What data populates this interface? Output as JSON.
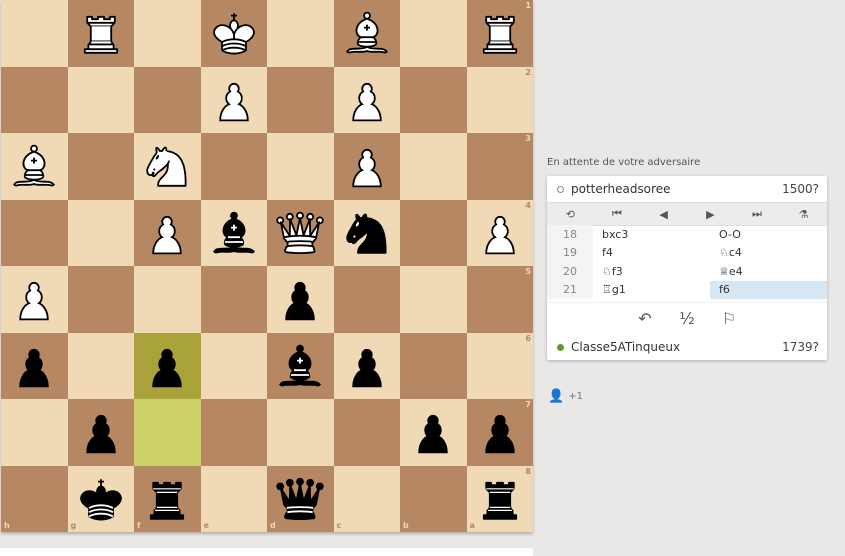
{
  "board": {
    "orientation": "black",
    "files_display": [
      "h",
      "g",
      "f",
      "e",
      "d",
      "c",
      "b",
      "a"
    ],
    "ranks_display": [
      "1",
      "2",
      "3",
      "4",
      "5",
      "6",
      "7",
      "8"
    ],
    "rows": [
      [
        "",
        "wR",
        "",
        "wK",
        "",
        "wB",
        "",
        "wR"
      ],
      [
        "",
        "",
        "",
        "wP",
        "",
        "wP",
        "",
        ""
      ],
      [
        "wB",
        "",
        "wN",
        "",
        "",
        "wP",
        "",
        ""
      ],
      [
        "",
        "",
        "wP",
        "bB",
        "wQ",
        "bN",
        "",
        "wP"
      ],
      [
        "wP",
        "",
        "",
        "",
        "bP",
        "",
        "",
        ""
      ],
      [
        "bP",
        "",
        "bP",
        "",
        "bB",
        "bP",
        "",
        ""
      ],
      [
        "",
        "bP",
        "",
        "",
        "",
        "",
        "bP",
        "bP"
      ],
      [
        "",
        "bK",
        "bR",
        "",
        "bQ",
        "",
        "",
        "bR"
      ]
    ],
    "last_move": [
      "f7",
      "f6"
    ],
    "colors": {
      "light": "#f0d9b5",
      "dark": "#b58863"
    }
  },
  "waiting_text": "En attente de votre adversaire",
  "top_player": {
    "name": "potterheadsoree",
    "rating": "1500?",
    "online": false
  },
  "bottom_player": {
    "name": "Classe5ATinqueux",
    "rating": "1739?",
    "online": true
  },
  "controls": [
    "flip-icon",
    "first-icon",
    "prev-icon",
    "next-icon",
    "last-icon",
    "analysis-icon"
  ],
  "moves": [
    {
      "num": "18",
      "white": "bxc3",
      "black": "O-O"
    },
    {
      "num": "19",
      "white": "f4",
      "black": "♘c4"
    },
    {
      "num": "20",
      "white": "♘f3",
      "black": "♕e4"
    },
    {
      "num": "21",
      "white": "♖g1",
      "black": "f6"
    }
  ],
  "actions": {
    "takeback_icon": "↶",
    "draw_label": "½",
    "resign_icon": "⚐"
  },
  "spectators": {
    "count": "+1"
  },
  "accent": {
    "online": "#629924",
    "active_move": "#d7e6f3"
  }
}
